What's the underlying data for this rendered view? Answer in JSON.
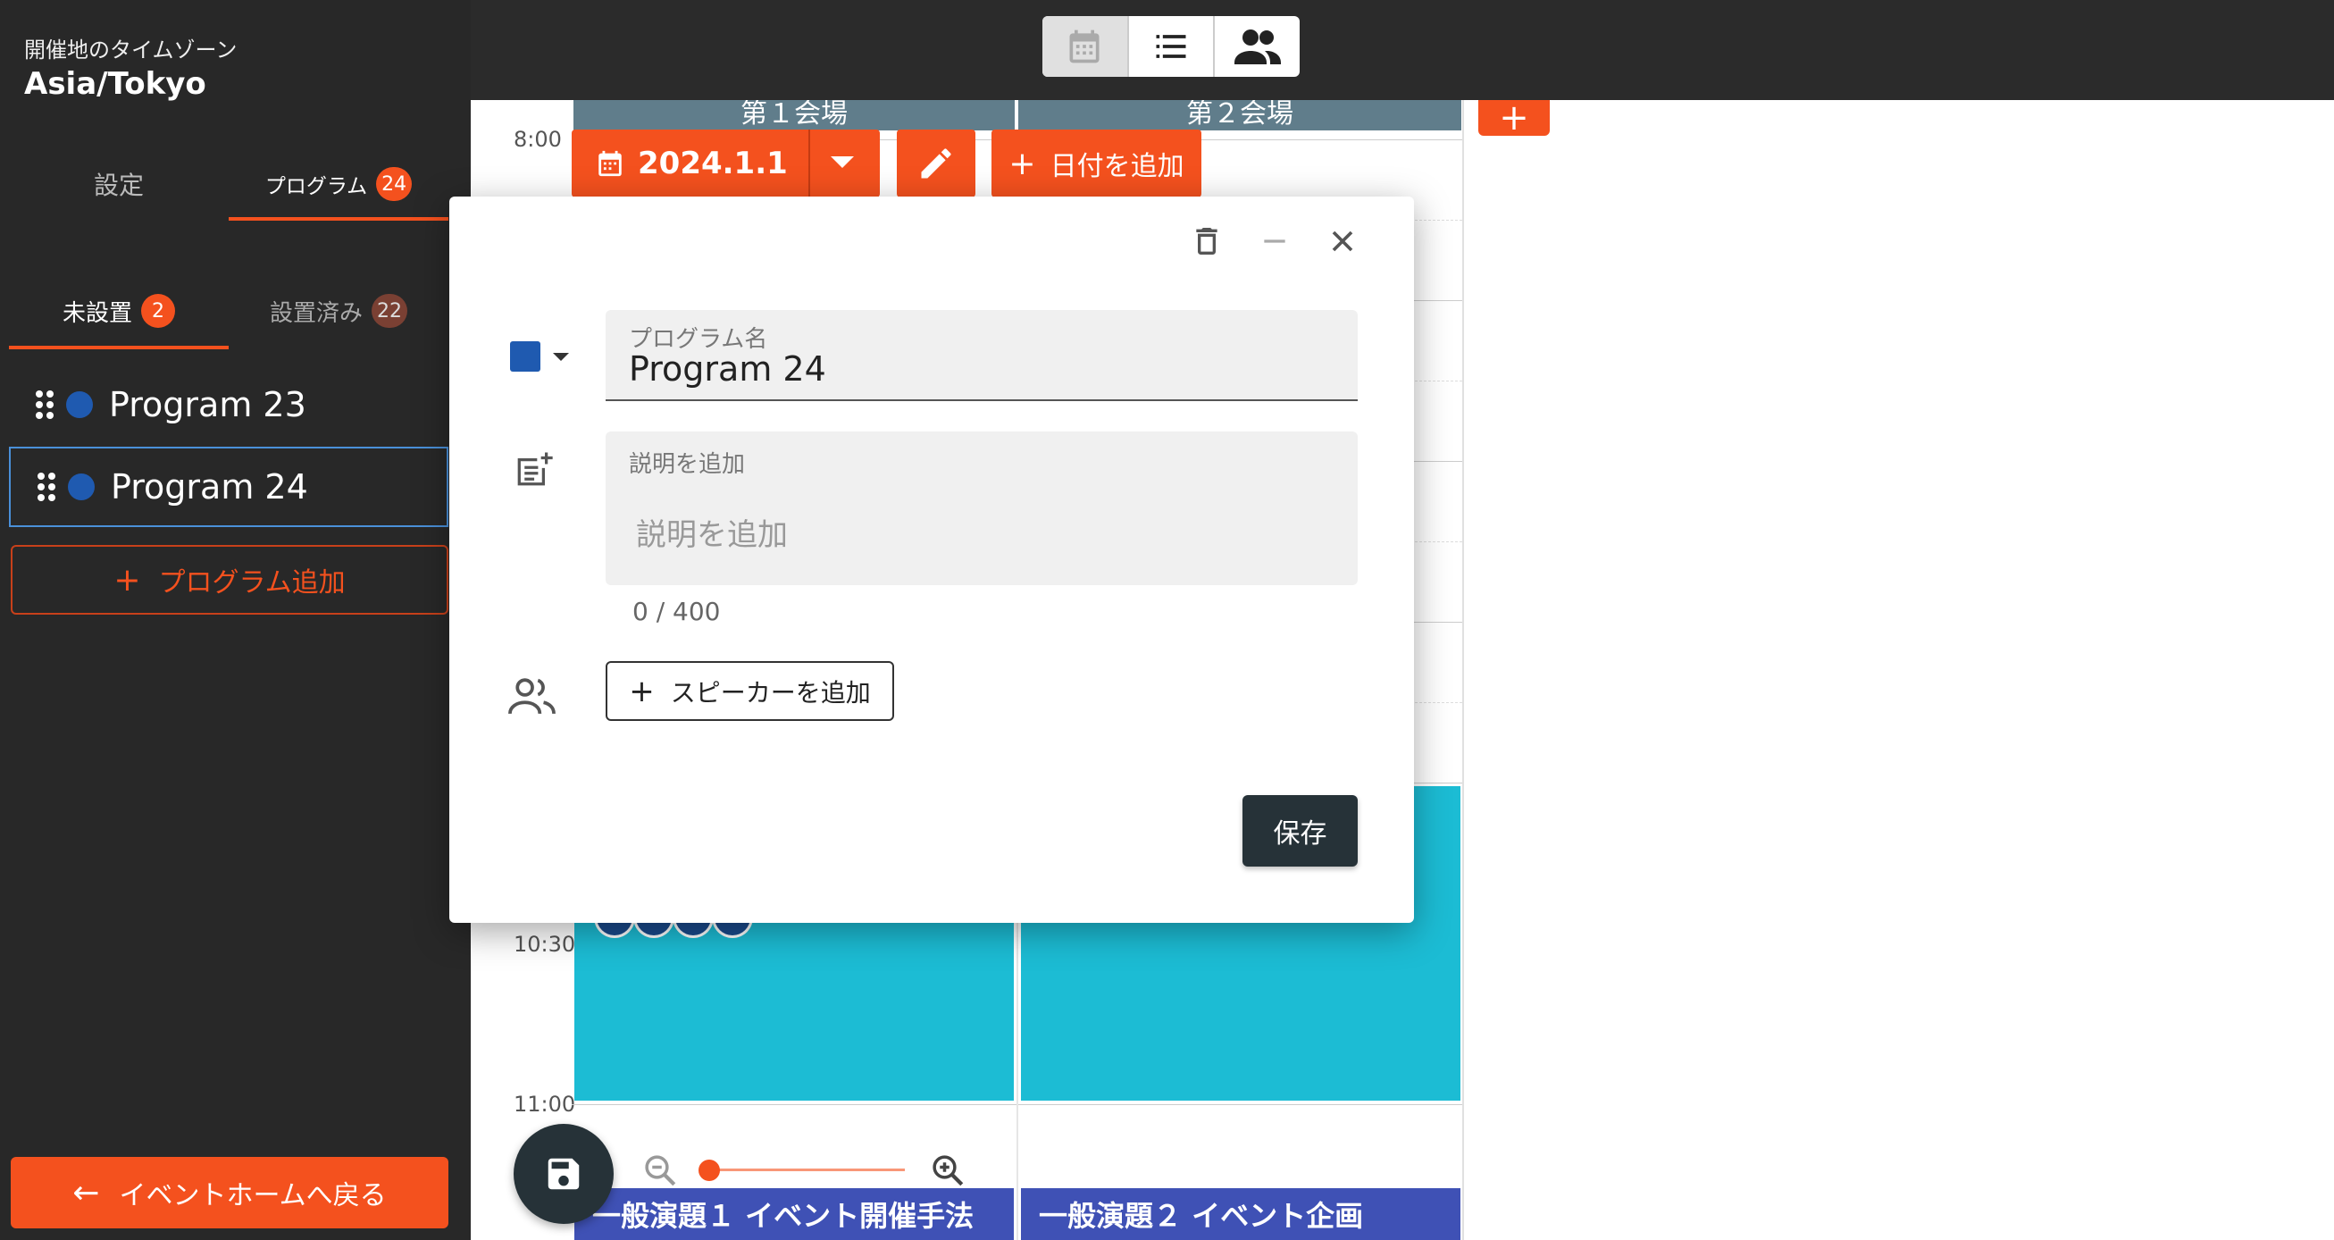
{
  "sidebar": {
    "timezone_label": "開催地のタイムゾーン",
    "timezone_value": "Asia/Tokyo",
    "tabs": [
      {
        "label": "設定"
      },
      {
        "label": "プログラム",
        "badge": "24"
      }
    ],
    "subtabs": [
      {
        "label": "未設置",
        "badge": "2"
      },
      {
        "label": "設置済み",
        "badge": "22"
      }
    ],
    "programs": [
      {
        "name": "Program 23"
      },
      {
        "name": "Program 24"
      }
    ],
    "add_program_label": "プログラム追加",
    "back_label": "イベントホームへ戻る"
  },
  "calendar": {
    "venues": [
      "第１会場",
      "第２会場"
    ],
    "add_venue_symbol": "+",
    "date_label": "2024.1.1",
    "add_date_label": "日付を追加",
    "times": [
      "8:00",
      "10:30",
      "11:00"
    ],
    "talks": [
      "一般演題１ イベント開催手法",
      "一般演題２ イベント企画"
    ]
  },
  "dialog": {
    "name_label": "プログラム名",
    "name_value": "Program 24",
    "desc_label": "説明を追加",
    "desc_placeholder": "説明を追加",
    "counter": "0 / 400",
    "add_speaker_label": "スピーカーを追加",
    "save_label": "保存"
  },
  "colors": {
    "accent": "#f4511e",
    "program_color": "#1f5ab0",
    "venue_header": "#607d8b",
    "block_cyan": "#1cbcd4",
    "talk_block": "#3f51b5",
    "dark": "#263238"
  }
}
